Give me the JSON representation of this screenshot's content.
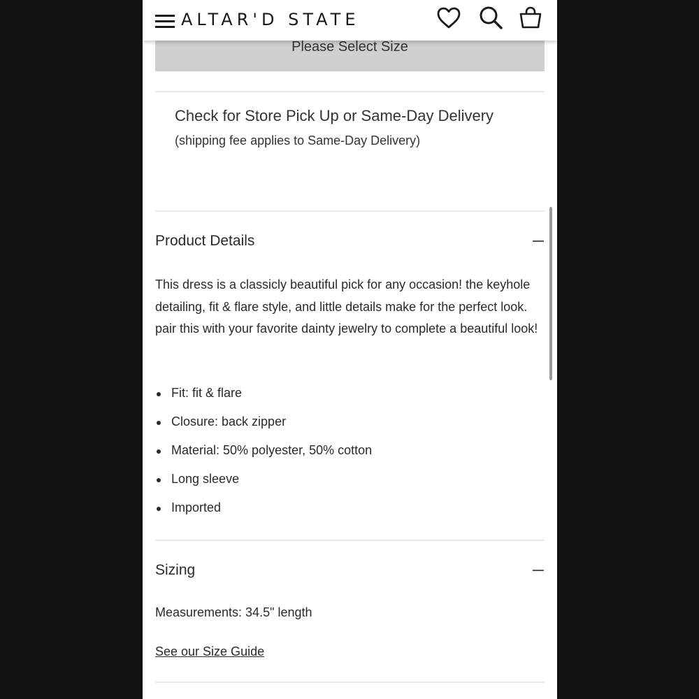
{
  "header": {
    "logo_text": "ALTAR'D STATE",
    "icons": [
      "menu-icon",
      "heart-icon",
      "search-icon",
      "bag-icon"
    ]
  },
  "size_button": {
    "label": "Please Select Size"
  },
  "pickup": {
    "title": "Check for Store Pick Up or Same-Day Delivery",
    "subtitle": "(shipping fee applies to Same-Day Delivery)"
  },
  "product_details": {
    "title": "Product Details",
    "description": "This dress is a classicly beautiful pick for any occasion! the keyhole detailing, fit & flare style, and little details make for the perfect look. pair this with your favorite dainty jewelry to complete a beautiful look!",
    "bullets": [
      "Fit: fit & flare",
      "Closure: back zipper",
      "Material: 50% polyester, 50% cotton",
      "Long sleeve",
      "Imported"
    ]
  },
  "sizing": {
    "title": "Sizing",
    "measurements": "Measurements: 34.5\" length",
    "guide_link": "See our Size Guide"
  },
  "colors": {
    "background": "#111111",
    "page": "#ffffff",
    "button_gray": "#cfcfcf",
    "text": "#2a2a2a"
  }
}
